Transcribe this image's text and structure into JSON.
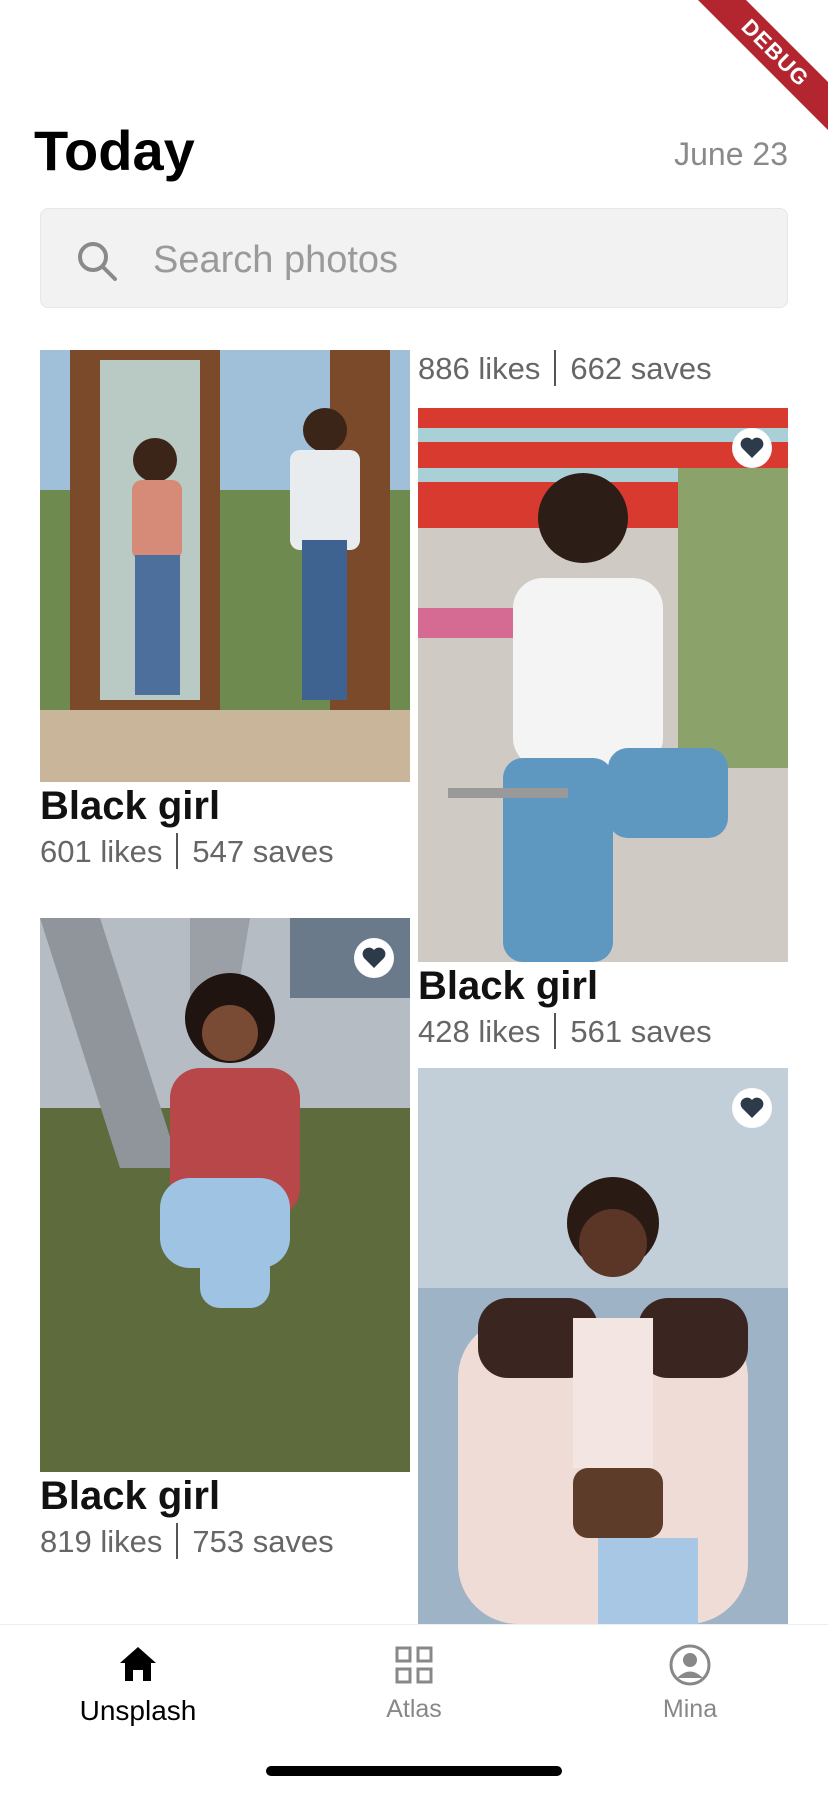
{
  "debug_banner": "DEBUG",
  "header": {
    "title": "Today",
    "date": "June 23"
  },
  "search": {
    "placeholder": "Search photos",
    "icon": "search-icon"
  },
  "top_right_stats": {
    "likes": "886 likes",
    "saves": "662 saves"
  },
  "photos": [
    {
      "title": "Black girl",
      "likes": "601 likes",
      "saves": "547 saves",
      "liked": false
    },
    {
      "title": "Black girl",
      "likes": "428 likes",
      "saves": "561 saves",
      "liked": true
    },
    {
      "title": "Black girl",
      "likes": "819 likes",
      "saves": "753 saves",
      "liked": true
    },
    {
      "title": "",
      "likes": "",
      "saves": "",
      "liked": true
    }
  ],
  "tabs": [
    {
      "label": "Unsplash",
      "icon": "home-icon",
      "active": true
    },
    {
      "label": "Atlas",
      "icon": "grid-icon",
      "active": false
    },
    {
      "label": "Mina",
      "icon": "account-icon",
      "active": false
    }
  ],
  "colors": {
    "accent": "#000000",
    "muted": "#888888",
    "debug": "#b3262f"
  }
}
